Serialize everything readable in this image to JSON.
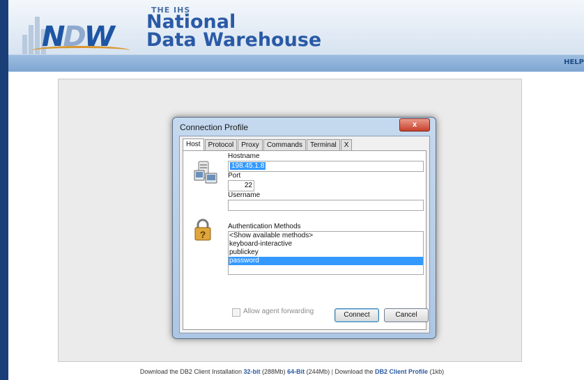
{
  "header": {
    "logo_text_part1": "N",
    "logo_text_part2": "D",
    "logo_text_part3": "W",
    "brand_small": "THE IHS",
    "brand_line1": "National",
    "brand_line2": "Data Warehouse"
  },
  "nav": {
    "help_label": "HELP"
  },
  "dialog": {
    "title": "Connection Profile",
    "close_label": "x",
    "tabs": [
      "Host",
      "Protocol",
      "Proxy",
      "Commands",
      "Terminal",
      "X"
    ],
    "active_tab": "Host",
    "hostname_label": "Hostname",
    "hostname_value": "198.45.1.8",
    "port_label": "Port",
    "port_value": "22",
    "username_label": "Username",
    "username_value": "",
    "auth_label": "Authentication Methods",
    "auth_methods": [
      "<Show available methods>",
      "keyboard-interactive",
      "publickey",
      "password"
    ],
    "auth_selected": "password",
    "agent_forwarding_label": "Allow agent forwarding",
    "agent_forwarding_checked": false,
    "connect_label": "Connect",
    "cancel_label": "Cancel",
    "icons": {
      "host": "computer-host-icon",
      "auth": "padlock-question-icon"
    }
  },
  "footer": {
    "text1": "Download the DB2 Client Installation",
    "link_32": "32-bit",
    "size_32": "(288Mb)",
    "link_64": "64-Bit",
    "size_64": "(244Mb)",
    "separator": "|",
    "text2": "Download the",
    "link_profile": "DB2 Client Profile",
    "size_profile": "(1kb)"
  },
  "colors": {
    "brand_blue": "#2a5aa6",
    "nav_blue": "#7ea6d2",
    "selection": "#3399ff",
    "close_red": "#c8402b"
  }
}
